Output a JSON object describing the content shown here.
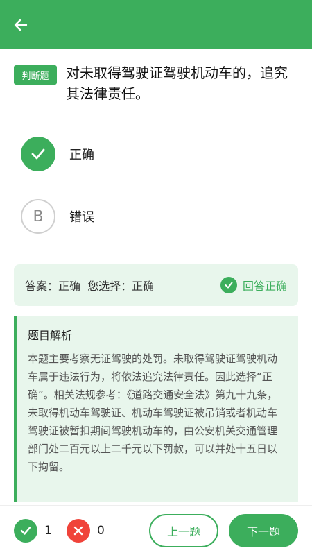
{
  "header": {
    "back_icon": "arrow-left-icon",
    "color": "#3cae5c"
  },
  "question": {
    "type_badge": "判断题",
    "text": "对未取得驾驶证驾驶机动车的，追究其法律责任。"
  },
  "options": [
    {
      "marker": "",
      "label": "正确",
      "state": "correct",
      "icon": "check-icon"
    },
    {
      "marker": "B",
      "label": "错误",
      "state": "unselected"
    }
  ],
  "answer": {
    "text": "答案：正确  您选择：正确",
    "result": "回答正确",
    "result_icon": "check-circle-icon"
  },
  "analysis": {
    "title": "题目解析",
    "body": "本题主要考察无证驾驶的处罚。未取得驾驶证驾驶机动车属于违法行为，将依法追究法律责任。因此选择“正确”。相关法规参考：《道路交通安全法》第九十九条，未取得机动车驾驶证、机动车驾驶证被吊销或者机动车驾驶证被暂扣期间驾驶机动车的，由公安机关交通管理部门处二百元以上二千元以下罚款，可以并处十五日以下拘留。"
  },
  "footer": {
    "correct_count": "1",
    "wrong_count": "0",
    "prev_label": "上一题",
    "next_label": "下一题"
  },
  "colors": {
    "accent": "#3cae5c",
    "error": "#f0433a",
    "panel": "#e8f6ec"
  }
}
